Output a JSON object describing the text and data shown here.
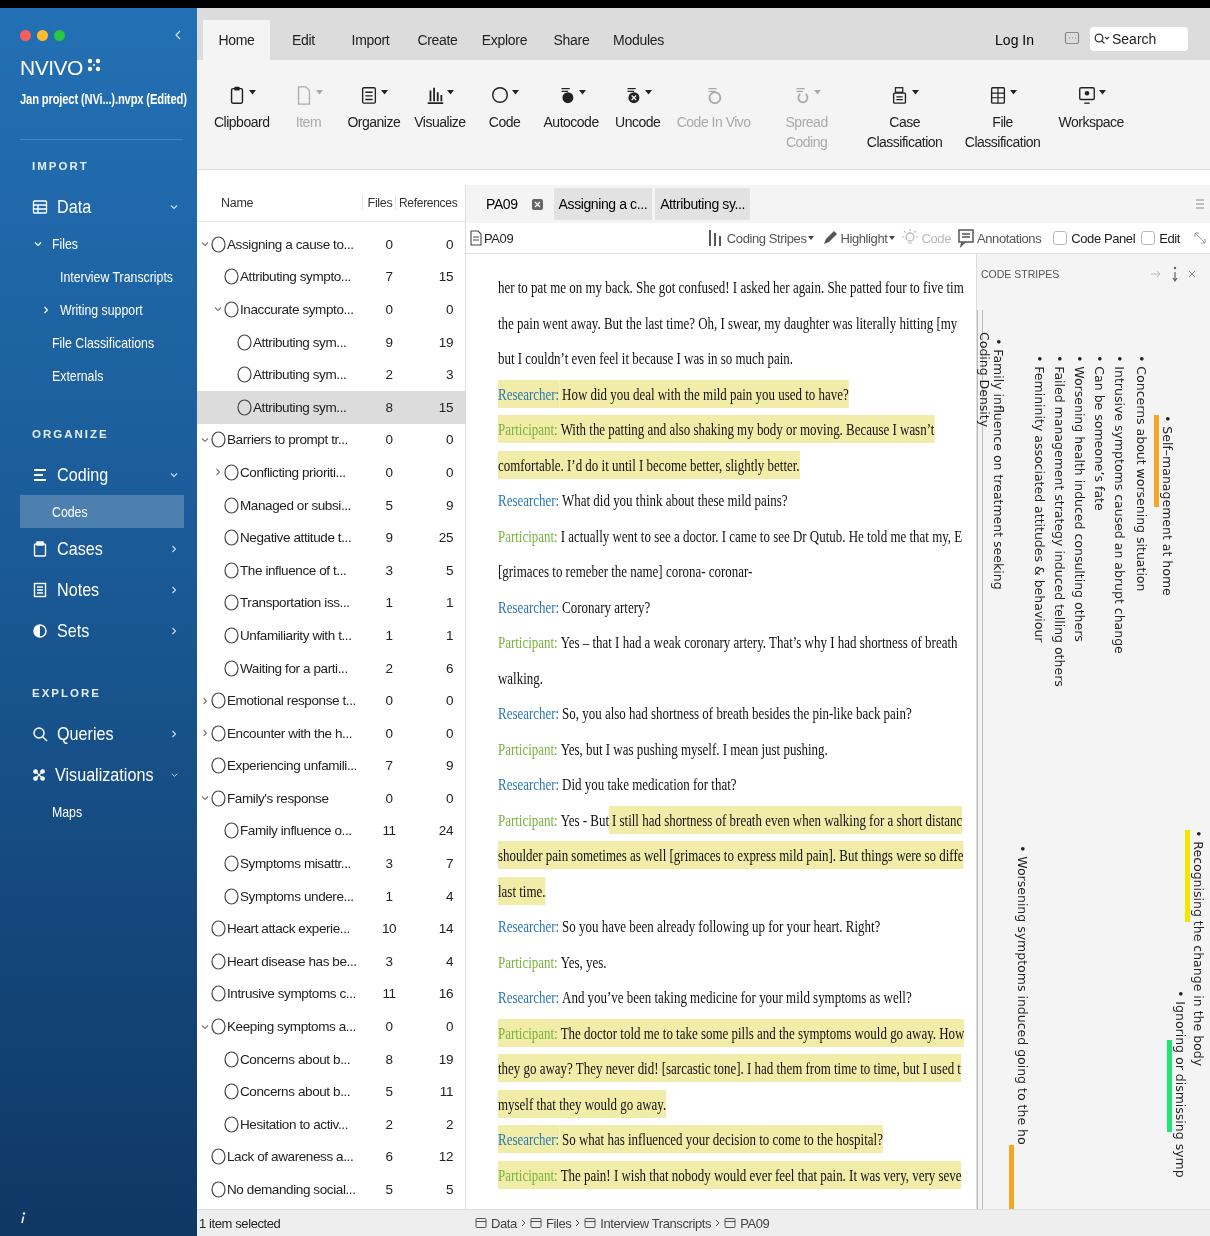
{
  "app": {
    "name": "NVIVO",
    "project": "Jan project (NVi...).nvpx (Edited)"
  },
  "sidebar": {
    "sections": [
      {
        "title": "IMPORT",
        "items": [
          {
            "label": "Data",
            "selected": false,
            "expanded": true,
            "children": [
              {
                "label": "Files",
                "selected": false,
                "expanded": true,
                "children": [
                  {
                    "label": "Interview Transcripts",
                    "selected": false
                  },
                  {
                    "label": "Writing support",
                    "selected": false,
                    "expanded": false
                  }
                ]
              },
              {
                "label": "File Classifications",
                "selected": false
              },
              {
                "label": "Externals",
                "selected": false
              }
            ]
          }
        ]
      },
      {
        "title": "ORGANIZE",
        "items": [
          {
            "label": "Coding",
            "selected": false,
            "expanded": true,
            "children": [
              {
                "label": "Codes",
                "selected": true
              }
            ]
          },
          {
            "label": "Cases",
            "selected": false,
            "expanded": false
          },
          {
            "label": "Notes",
            "selected": false,
            "expanded": false
          },
          {
            "label": "Sets",
            "selected": false,
            "expanded": false
          }
        ]
      },
      {
        "title": "EXPLORE",
        "items": [
          {
            "label": "Queries",
            "selected": false,
            "expanded": false
          },
          {
            "label": "Visualizations",
            "selected": false,
            "expanded": true,
            "children": [
              {
                "label": "Maps",
                "selected": false
              }
            ]
          }
        ]
      }
    ]
  },
  "ribbon": {
    "tabs": [
      {
        "label": "Home",
        "selected": true
      },
      {
        "label": "Edit",
        "selected": false
      },
      {
        "label": "Import",
        "selected": false
      },
      {
        "label": "Create",
        "selected": false
      },
      {
        "label": "Explore",
        "selected": false
      },
      {
        "label": "Share",
        "selected": false
      },
      {
        "label": "Modules",
        "selected": false
      }
    ],
    "login": "Log In",
    "search": {
      "placeholder": "Search"
    },
    "buttons": [
      {
        "label": "Clipboard",
        "disabled": false,
        "dropdown": true
      },
      {
        "label": "Item",
        "disabled": true,
        "dropdown": true
      },
      {
        "label": "Organize",
        "disabled": false,
        "dropdown": true
      },
      {
        "label": "Visualize",
        "disabled": false,
        "dropdown": true
      },
      {
        "label": "Code",
        "disabled": false,
        "dropdown": true
      },
      {
        "label": "Autocode",
        "disabled": false,
        "dropdown": true
      },
      {
        "label": "Uncode",
        "disabled": false,
        "dropdown": true
      },
      {
        "label": "Code In Vivo",
        "disabled": true,
        "dropdown": false
      },
      {
        "label": "Spread Coding",
        "disabled": true,
        "dropdown": true
      },
      {
        "label": "Case Classification",
        "disabled": false,
        "dropdown": true
      },
      {
        "label": "File Classification",
        "disabled": false,
        "dropdown": true
      },
      {
        "label": "Workspace",
        "disabled": false,
        "dropdown": true
      }
    ]
  },
  "code_list": {
    "columns": [
      "Name",
      "Files",
      "References"
    ],
    "rows": [
      {
        "name": "Assigning a cause to...",
        "files": "0",
        "references": "0",
        "selected": false,
        "expanded": true,
        "children": [
          {
            "name": "Attributing sympto...",
            "files": "7",
            "references": "15",
            "selected": false
          },
          {
            "name": "Inaccurate sympto...",
            "files": "0",
            "references": "0",
            "selected": false,
            "expanded": true,
            "children": [
              {
                "name": "Attributing sym...",
                "files": "9",
                "references": "19",
                "selected": false
              },
              {
                "name": "Attributing sym...",
                "files": "2",
                "references": "3",
                "selected": false
              },
              {
                "name": "Attributing sym...",
                "files": "8",
                "references": "15",
                "selected": true
              }
            ]
          }
        ]
      },
      {
        "name": "Barriers to prompt tr...",
        "files": "0",
        "references": "0",
        "selected": false,
        "expanded": true,
        "children": [
          {
            "name": "Conflicting prioriti...",
            "files": "0",
            "references": "0",
            "selected": false,
            "expanded": false
          },
          {
            "name": "Managed or subsi...",
            "files": "5",
            "references": "9",
            "selected": false
          },
          {
            "name": "Negative attitude t...",
            "files": "9",
            "references": "25",
            "selected": false
          },
          {
            "name": "The influence of t...",
            "files": "3",
            "references": "5",
            "selected": false
          },
          {
            "name": "Transportation iss...",
            "files": "1",
            "references": "1",
            "selected": false
          },
          {
            "name": "Unfamiliarity with t...",
            "files": "1",
            "references": "1",
            "selected": false
          },
          {
            "name": "Waiting for a parti...",
            "files": "2",
            "references": "6",
            "selected": false
          }
        ]
      },
      {
        "name": "Emotional response t...",
        "files": "0",
        "references": "0",
        "selected": false,
        "expanded": false
      },
      {
        "name": "Encounter with the h...",
        "files": "0",
        "references": "0",
        "selected": false,
        "expanded": false
      },
      {
        "name": "Experiencing unfamili...",
        "files": "7",
        "references": "9",
        "selected": false
      },
      {
        "name": "Family's response",
        "files": "0",
        "references": "0",
        "selected": false,
        "expanded": true,
        "children": [
          {
            "name": "Family influence o...",
            "files": "11",
            "references": "24",
            "selected": false
          },
          {
            "name": "Symptoms misattr...",
            "files": "3",
            "references": "7",
            "selected": false
          },
          {
            "name": "Symptoms undere...",
            "files": "1",
            "references": "4",
            "selected": false
          }
        ]
      },
      {
        "name": "Heart attack experie...",
        "files": "10",
        "references": "14",
        "selected": false
      },
      {
        "name": "Heart disease has be...",
        "files": "3",
        "references": "4",
        "selected": false
      },
      {
        "name": "Intrusive symptoms c...",
        "files": "11",
        "references": "16",
        "selected": false
      },
      {
        "name": "Keeping symptoms a...",
        "files": "0",
        "references": "0",
        "selected": false,
        "expanded": true,
        "children": [
          {
            "name": "Concerns about b...",
            "files": "8",
            "references": "19",
            "selected": false
          },
          {
            "name": "Concerns about b...",
            "files": "5",
            "references": "11",
            "selected": false
          },
          {
            "name": "Hesitation to activ...",
            "files": "2",
            "references": "2",
            "selected": false
          }
        ]
      },
      {
        "name": "Lack of awareness a...",
        "files": "6",
        "references": "12",
        "selected": false
      },
      {
        "name": "No demanding social...",
        "files": "5",
        "references": "5",
        "selected": false
      }
    ],
    "status": "1 item selected"
  },
  "document": {
    "tabs": [
      {
        "label": "PA09",
        "selected": true
      },
      {
        "label": "Assigning a c...",
        "selected": false
      },
      {
        "label": "Attributing sy...",
        "selected": false
      }
    ],
    "title": "PA09",
    "toolbar": [
      {
        "label": "Coding Stripes",
        "dropdown": true,
        "disabled": false
      },
      {
        "label": "Highlight",
        "dropdown": true,
        "disabled": false
      },
      {
        "label": "Code",
        "dropdown": false,
        "disabled": true
      },
      {
        "label": "Annotations",
        "dropdown": false,
        "disabled": false
      }
    ],
    "checkboxes": [
      {
        "label": "Code Panel",
        "checked": false
      },
      {
        "label": "Edit",
        "checked": false
      }
    ],
    "lines": [
      {
        "segments": [
          {
            "kind": "text",
            "text": "her to pat me on my back. She got confused! I asked her again. She patted four to five tim",
            "highlighted": false
          }
        ]
      },
      {
        "segments": [
          {
            "kind": "text",
            "text": "the pain went away. But the last time? Oh, I swear, my daughter was literally hitting [my",
            "highlighted": false
          }
        ]
      },
      {
        "segments": [
          {
            "kind": "text",
            "text": "but I couldn’t even feel it because I was in so much pain.",
            "highlighted": false
          }
        ]
      },
      {
        "segments": [
          {
            "kind": "researcher",
            "text": "Researcher:",
            "highlighted": true
          },
          {
            "kind": "text",
            "text": "How did you deal with the mild pain you used to have?",
            "highlighted": true
          }
        ]
      },
      {
        "segments": [
          {
            "kind": "participant",
            "text": "Participant:",
            "highlighted": true
          },
          {
            "kind": "text",
            "text": "With the patting and also shaking my body or moving. Because I wasn’t",
            "highlighted": true
          }
        ]
      },
      {
        "segments": [
          {
            "kind": "text",
            "text": "comfortable. I’d do it until I become better, slightly better.",
            "highlighted": true
          }
        ]
      },
      {
        "segments": [
          {
            "kind": "researcher",
            "text": "Researcher:",
            "highlighted": false
          },
          {
            "kind": "text",
            "text": "What did you think about these mild pains?",
            "highlighted": false
          }
        ]
      },
      {
        "segments": [
          {
            "kind": "participant",
            "text": "Participant:",
            "highlighted": false
          },
          {
            "kind": "text",
            "text": "I actually went to see a doctor. I came to see Dr Qutub. He told me that my, E",
            "highlighted": false
          }
        ]
      },
      {
        "segments": [
          {
            "kind": "text",
            "text": "[grimaces to remeber the name] corona- coronar-",
            "highlighted": false
          }
        ]
      },
      {
        "segments": [
          {
            "kind": "researcher",
            "text": "Researcher:",
            "highlighted": false
          },
          {
            "kind": "text",
            "text": "Coronary artery?",
            "highlighted": false
          }
        ]
      },
      {
        "segments": [
          {
            "kind": "participant",
            "text": "Participant:",
            "highlighted": false
          },
          {
            "kind": "text",
            "text": "Yes – that I had a weak coronary artery. That’s why I had shortness of breath",
            "highlighted": false
          }
        ]
      },
      {
        "segments": [
          {
            "kind": "text",
            "text": "walking.",
            "highlighted": false
          }
        ]
      },
      {
        "segments": [
          {
            "kind": "researcher",
            "text": "Researcher:",
            "highlighted": false
          },
          {
            "kind": "text",
            "text": "So, you also had shortness of breath besides the pin-like back pain?",
            "highlighted": false
          }
        ]
      },
      {
        "segments": [
          {
            "kind": "participant",
            "text": "Participant:",
            "highlighted": false
          },
          {
            "kind": "text",
            "text": "Yes, but I was pushing myself. I mean just pushing.",
            "highlighted": false
          }
        ]
      },
      {
        "segments": [
          {
            "kind": "researcher",
            "text": "Researcher:",
            "highlighted": false
          },
          {
            "kind": "text",
            "text": "Did you take medication for that?",
            "highlighted": false
          }
        ]
      },
      {
        "segments": [
          {
            "kind": "participant",
            "text": "Participant:",
            "highlighted": false
          },
          {
            "kind": "text",
            "text": "Yes - But",
            "highlighted": false
          },
          {
            "kind": "text",
            "text": "I still had shortness of breath even when walking for a short distanc",
            "highlighted": true
          }
        ]
      },
      {
        "segments": [
          {
            "kind": "text",
            "text": "shoulder pain sometimes as well [grimaces to express mild pain]. But things were so diffe",
            "highlighted": true
          }
        ]
      },
      {
        "segments": [
          {
            "kind": "text",
            "text": "last time.",
            "highlighted": true
          }
        ]
      },
      {
        "segments": [
          {
            "kind": "researcher",
            "text": "Researcher:",
            "highlighted": false
          },
          {
            "kind": "text",
            "text": "So you have been already following up for your heart. Right?",
            "highlighted": false
          }
        ]
      },
      {
        "segments": [
          {
            "kind": "participant",
            "text": "Participant:",
            "highlighted": false
          },
          {
            "kind": "text",
            "text": "Yes, yes.",
            "highlighted": false
          }
        ]
      },
      {
        "segments": [
          {
            "kind": "researcher",
            "text": "Researcher:",
            "highlighted": false
          },
          {
            "kind": "text",
            "text": "And you’ve been taking medicine for your mild symptoms as well?",
            "highlighted": false
          }
        ]
      },
      {
        "segments": [
          {
            "kind": "participant",
            "text": "Participant:",
            "highlighted": true
          },
          {
            "kind": "text",
            "text": "The doctor told me to take some pills and the symptoms would go away. How",
            "highlighted": true
          }
        ]
      },
      {
        "segments": [
          {
            "kind": "text",
            "text": "they go away? They never did! [sarcastic tone]. I had them from time to time, but I used t",
            "highlighted": true
          }
        ]
      },
      {
        "segments": [
          {
            "kind": "text",
            "text": "myself that they would go away.",
            "highlighted": true
          }
        ]
      },
      {
        "segments": [
          {
            "kind": "researcher",
            "text": "Researcher:",
            "highlighted": true
          },
          {
            "kind": "text",
            "text": "So what has influenced your decision to come to the hospital?",
            "highlighted": true
          }
        ]
      },
      {
        "segments": [
          {
            "kind": "participant",
            "text": "Participant:",
            "highlighted": true
          },
          {
            "kind": "text",
            "text": "The pain! I wish that nobody would ever feel that pain. It was very, very seve",
            "highlighted": true
          }
        ]
      }
    ],
    "breadcrumb": [
      "Data",
      "Files",
      "Interview Transcripts",
      "PA09"
    ]
  },
  "code_stripes": {
    "title": "CODE STRIPES",
    "stripes": [
      {
        "label": "• Self–management at home",
        "color": "#f5a623"
      },
      {
        "label": "• Concerns about worsening situation"
      },
      {
        "label": "• Intrusive symptoms caused an abrupt change"
      },
      {
        "label": "• Can be someone’s fate"
      },
      {
        "label": "• Worsening health induced consulting others"
      },
      {
        "label": "• Failed management strategy induced telling others"
      },
      {
        "label": "• Femininity associated attitudes & behaviour"
      },
      {
        "label": "• Family influence on treatment seeking"
      },
      {
        "label": "Coding Density"
      },
      {
        "label": "• Recognising the change in the body",
        "color": "#f2e600"
      },
      {
        "label": "• Ignoring or dismissing symp",
        "color": "#22e27a"
      },
      {
        "label": "• Worsening symptoms induced going to the ho",
        "color": "#f5a623"
      }
    ]
  }
}
